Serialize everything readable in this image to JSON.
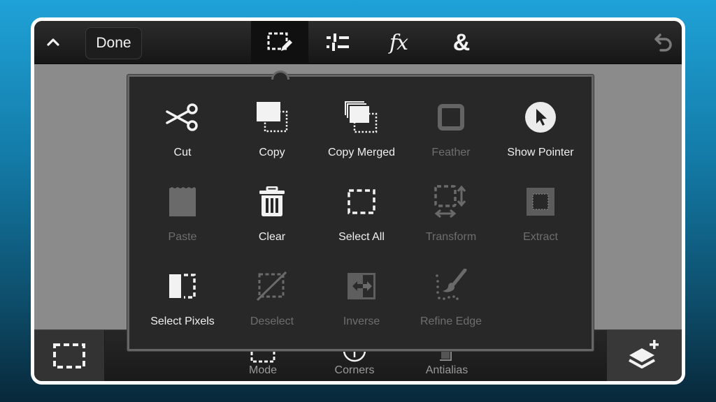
{
  "colors": {
    "background_top": "#1fa2d8",
    "background_bottom": "#08283a",
    "frame_border": "#ffffff",
    "toolbar": "#1c1c1c",
    "canvas": "#8b8b8b",
    "popup_bg": "#282828",
    "enabled_text": "#f0f0f0",
    "disabled_text": "#6e6e6e"
  },
  "topbar": {
    "collapse_icon": "chevron-up-icon",
    "done_label": "Done",
    "tabs": [
      {
        "icon": "selection-edit-icon",
        "active": true
      },
      {
        "icon": "adjustments-sliders-icon",
        "active": false
      },
      {
        "icon": "fx-icon",
        "glyph": "fx",
        "active": false
      },
      {
        "icon": "blend-ampersand-icon",
        "glyph": "&",
        "active": false
      }
    ],
    "undo_icon": "undo-icon"
  },
  "popup": {
    "items": [
      {
        "label": "Cut",
        "icon": "scissors-icon",
        "enabled": true
      },
      {
        "label": "Copy",
        "icon": "copy-icon",
        "enabled": true
      },
      {
        "label": "Copy Merged",
        "icon": "copy-merged-icon",
        "enabled": true
      },
      {
        "label": "Feather",
        "icon": "feather-icon",
        "enabled": false
      },
      {
        "label": "Show Pointer",
        "icon": "pointer-icon",
        "enabled": true
      },
      {
        "label": "Paste",
        "icon": "paste-icon",
        "enabled": false
      },
      {
        "label": "Clear",
        "icon": "trash-icon",
        "enabled": true
      },
      {
        "label": "Select All",
        "icon": "select-all-icon",
        "enabled": true
      },
      {
        "label": "Transform",
        "icon": "transform-icon",
        "enabled": false
      },
      {
        "label": "Extract",
        "icon": "extract-icon",
        "enabled": false
      },
      {
        "label": "Select Pixels",
        "icon": "select-pixels-icon",
        "enabled": true
      },
      {
        "label": "Deselect",
        "icon": "deselect-icon",
        "enabled": false
      },
      {
        "label": "Inverse",
        "icon": "inverse-icon",
        "enabled": false
      },
      {
        "label": "Refine Edge",
        "icon": "refine-edge-icon",
        "enabled": false
      }
    ]
  },
  "bottombar": {
    "left_icon": "marquee-selection-icon",
    "options": [
      {
        "label": "Mode",
        "icon": "mode-icon"
      },
      {
        "label": "Corners",
        "icon": "corners-icon"
      },
      {
        "label": "Antialias",
        "icon": "antialias-icon"
      }
    ],
    "right_icon": "add-layer-icon"
  }
}
